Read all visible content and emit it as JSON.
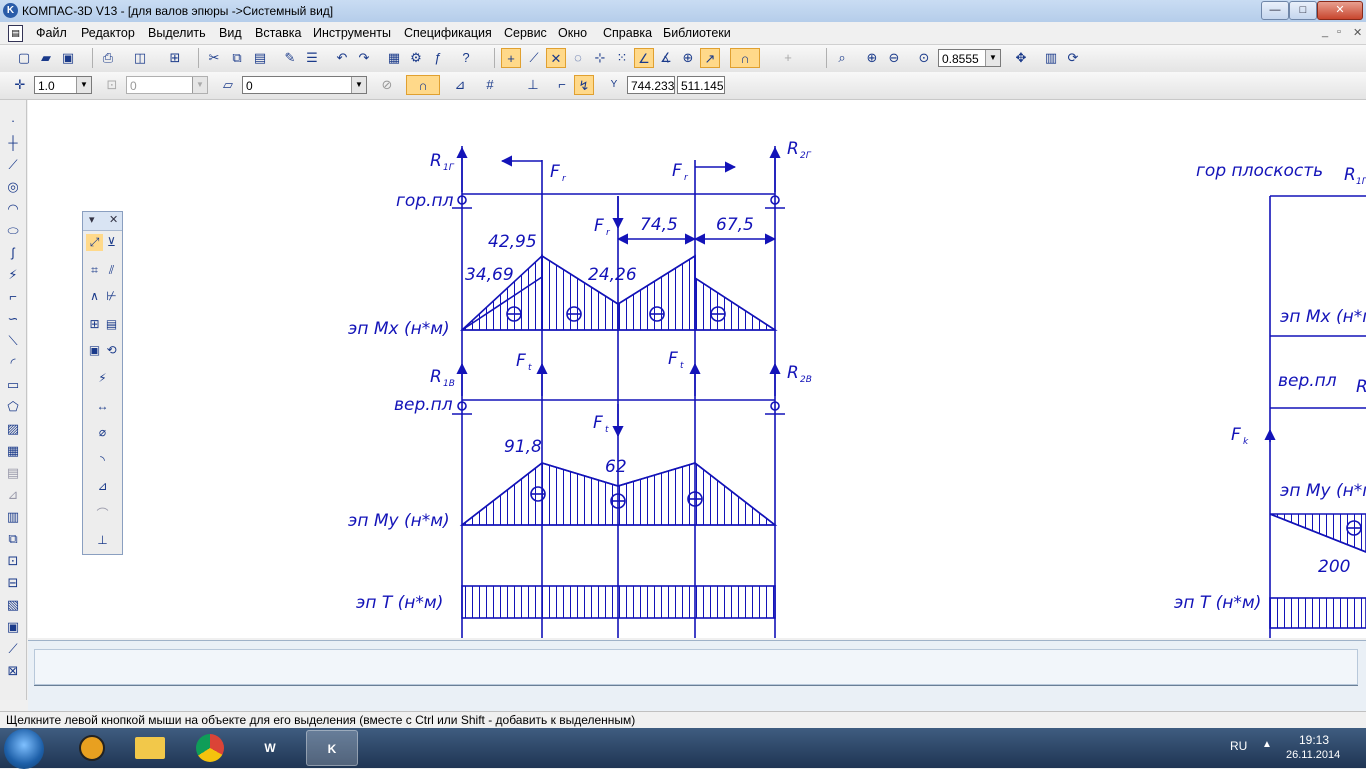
{
  "window": {
    "title": "КОМПАС-3D V13 - [для валов эпюры ->Системный вид]",
    "app_icon_letter": "K",
    "minimize": "—",
    "maximize": "□",
    "close": "✕"
  },
  "menu": {
    "items": [
      "Файл",
      "Редактор",
      "Выделить",
      "Вид",
      "Вставка",
      "Инструменты",
      "Спецификация",
      "Сервис",
      "Окно",
      "Справка",
      "Библиотеки"
    ],
    "mdi_minimize": "_",
    "mdi_restore": "▫",
    "mdi_close": "✕"
  },
  "toolbar1": {
    "zoom_value": "0.8555"
  },
  "toolbar2": {
    "step_value": "1.0",
    "angle_value": "0",
    "layer_value": "0",
    "coord_x": "744.233",
    "coord_y": "511.145",
    "coord_label": "Y"
  },
  "palette": {
    "collapse": "▾",
    "close": "✕"
  },
  "drawing": {
    "left": {
      "rows": {
        "gor": "гор.пл",
        "mx": "эп Mx (н*м)",
        "ver": "вер.пл",
        "my": "эп My (н*м)",
        "t": "эп T (н*м)"
      },
      "forces": {
        "r1g": "R",
        "r1g_sub": "1Г",
        "r2g": "R",
        "r2g_sub": "2Г",
        "r1v": "R",
        "r1v_sub": "1В",
        "r2v": "R",
        "r2v_sub": "2В",
        "fr": "F",
        "fr_sub": "r",
        "ft": "F",
        "ft_sub": "t"
      },
      "dims": [
        "74,5",
        "67,5"
      ],
      "mx_values": [
        "42,95",
        "34,69",
        "24,26"
      ],
      "my_values": [
        "91,8",
        "62"
      ]
    },
    "right": {
      "gor_plane": "гор плоскость",
      "r": "R",
      "r_sub": "1Г",
      "mx": "эп Mx (н*м)",
      "ver": "вер.пл",
      "r_ver": "R",
      "fk": "F",
      "fk_sub": "k",
      "my": "эп My (н*м)",
      "my_value": "200",
      "t": "эп T (н*м)"
    }
  },
  "status": {
    "message": "Щелкните левой кнопкой мыши на объекте для его выделения (вместе с Ctrl или Shift - добавить к выделенным)"
  },
  "taskbar": {
    "word_label": "W",
    "kompas_label": "K",
    "lang": "RU",
    "time": "19:13",
    "date": "26.11.2014"
  },
  "colors": {
    "drawing": "#1313b8",
    "highlight": "#ffd98a"
  }
}
